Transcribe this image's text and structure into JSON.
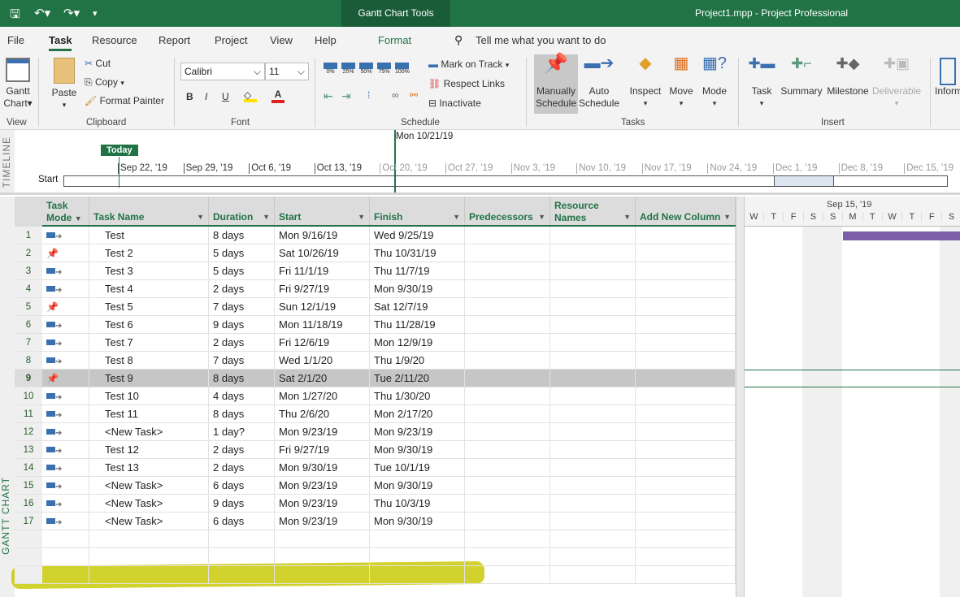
{
  "titlebar": {
    "context": "Gantt Chart Tools",
    "title": "Project1.mpp  -  Project Professional"
  },
  "menu": [
    "File",
    "Task",
    "Resource",
    "Report",
    "Project",
    "View",
    "Help",
    "Format"
  ],
  "tell_me": "Tell me what you want to do",
  "ribbon": {
    "view": {
      "gantt": "Gantt",
      "chart": "Chart",
      "group": "View"
    },
    "clipboard": {
      "paste": "Paste",
      "cut": "Cut",
      "copy": "Copy",
      "format_painter": "Format Painter",
      "group": "Clipboard"
    },
    "font": {
      "family": "Calibri",
      "size": "11",
      "bold": "B",
      "italic": "I",
      "underline": "U",
      "group": "Font"
    },
    "schedule": {
      "pcts": [
        "0%",
        "25%",
        "50%",
        "75%",
        "100%"
      ],
      "mark_on_track": "Mark on Track",
      "respect_links": "Respect Links",
      "inactivate": "Inactivate",
      "group": "Schedule"
    },
    "tasks": {
      "manually": "Manually",
      "schedule": "Schedule",
      "auto": "Auto",
      "inspect": "Inspect",
      "move": "Move",
      "mode": "Mode",
      "group": "Tasks"
    },
    "insert": {
      "task": "Task",
      "summary": "Summary",
      "milestone": "Milestone",
      "deliverable": "Deliverable",
      "group": "Insert"
    },
    "info": "Inform"
  },
  "timeline": {
    "label": "TIMELINE",
    "today": "Today",
    "start": "Start",
    "current": "Mon 10/21/19",
    "ticks": [
      "Sep 22, '19",
      "Sep 29, '19",
      "Oct 6, '19",
      "Oct 13, '19",
      "Oct 20, '19",
      "Oct 27, '19",
      "Nov 3, '19",
      "Nov 10, '19",
      "Nov 17, '19",
      "Nov 24, '19",
      "Dec 1, '19",
      "Dec 8, '19",
      "Dec 15, '19"
    ]
  },
  "side_label": "GANTT CHART",
  "columns": {
    "mode1": "Task",
    "mode2": "Mode",
    "name": "Task Name",
    "duration": "Duration",
    "start": "Start",
    "finish": "Finish",
    "pred": "Predecessors",
    "res1": "Resource",
    "res2": "Names",
    "add": "Add New Column"
  },
  "gantt": {
    "week": "Sep 15, '19",
    "days": [
      "W",
      "T",
      "F",
      "S",
      "S",
      "M",
      "T",
      "W",
      "T",
      "F",
      "S"
    ],
    "bar_color": "#7a5fa8"
  },
  "tasks": [
    {
      "id": "1",
      "mode": "auto",
      "name": "Test",
      "duration": "8 days",
      "start": "Mon 9/16/19",
      "finish": "Wed 9/25/19"
    },
    {
      "id": "2",
      "mode": "manual",
      "name": "Test 2",
      "duration": "5 days",
      "start": "Sat 10/26/19",
      "finish": "Thu 10/31/19"
    },
    {
      "id": "3",
      "mode": "auto",
      "name": "Test 3",
      "duration": "5 days",
      "start": "Fri 11/1/19",
      "finish": "Thu 11/7/19"
    },
    {
      "id": "4",
      "mode": "auto",
      "name": "Test 4",
      "duration": "2 days",
      "start": "Fri 9/27/19",
      "finish": "Mon 9/30/19"
    },
    {
      "id": "5",
      "mode": "manual",
      "name": "Test 5",
      "duration": "7 days",
      "start": "Sun 12/1/19",
      "finish": "Sat 12/7/19"
    },
    {
      "id": "6",
      "mode": "auto",
      "name": "Test 6",
      "duration": "9 days",
      "start": "Mon 11/18/19",
      "finish": "Thu 11/28/19"
    },
    {
      "id": "7",
      "mode": "auto",
      "name": "Test 7",
      "duration": "2 days",
      "start": "Fri 12/6/19",
      "finish": "Mon 12/9/19"
    },
    {
      "id": "8",
      "mode": "auto",
      "name": "Test 8",
      "duration": "7 days",
      "start": "Wed 1/1/20",
      "finish": "Thu 1/9/20"
    },
    {
      "id": "9",
      "mode": "manual",
      "name": "Test 9",
      "duration": "8 days",
      "start": "Sat 2/1/20",
      "finish": "Tue 2/11/20"
    },
    {
      "id": "10",
      "mode": "auto",
      "name": "Test 10",
      "duration": "4 days",
      "start": "Mon 1/27/20",
      "finish": "Thu 1/30/20"
    },
    {
      "id": "11",
      "mode": "auto",
      "name": "Test 11",
      "duration": "8 days",
      "start": "Thu 2/6/20",
      "finish": "Mon 2/17/20"
    },
    {
      "id": "12",
      "mode": "auto",
      "name": "<New Task>",
      "duration": "1 day?",
      "start": "Mon 9/23/19",
      "finish": "Mon 9/23/19"
    },
    {
      "id": "13",
      "mode": "auto",
      "name": "Test 12",
      "duration": "2 days",
      "start": "Fri 9/27/19",
      "finish": "Mon 9/30/19"
    },
    {
      "id": "14",
      "mode": "auto",
      "name": "Test 13",
      "duration": "2 days",
      "start": "Mon 9/30/19",
      "finish": "Tue 10/1/19"
    },
    {
      "id": "15",
      "mode": "auto",
      "name": "<New Task>",
      "duration": "6 days",
      "start": "Mon 9/23/19",
      "finish": "Mon 9/30/19"
    },
    {
      "id": "16",
      "mode": "auto",
      "name": "<New Task>",
      "duration": "9 days",
      "start": "Mon 9/23/19",
      "finish": "Thu 10/3/19"
    },
    {
      "id": "17",
      "mode": "auto",
      "name": "<New Task>",
      "duration": "6 days",
      "start": "Mon 9/23/19",
      "finish": "Mon 9/30/19"
    }
  ]
}
